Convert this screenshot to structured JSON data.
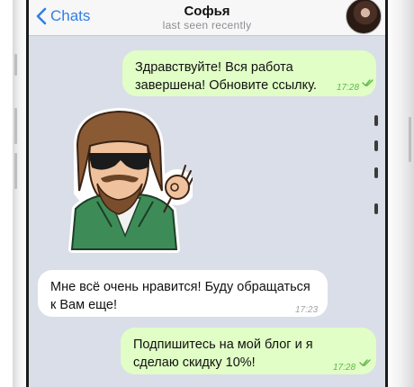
{
  "header": {
    "back_label": "Chats",
    "title": "Софья",
    "status": "last seen recently"
  },
  "messages": [
    {
      "direction": "out",
      "text": "Здравствуйте! Вся работа\nзавершена! Обновите ссылку.",
      "time": "17:28"
    },
    {
      "direction": "in",
      "type": "sticker",
      "sticker": "bearded-man-sunglasses-ok-sticker"
    },
    {
      "direction": "in",
      "text": "Мне всё очень нравится! Буду обращаться\nк Вам еще!",
      "time": "17:23"
    },
    {
      "direction": "out",
      "text": "Подпишитесь на мой блог и я\nсделаю скидку 10%!",
      "time": "17:28"
    }
  ],
  "colors": {
    "accent": "#2f7fe8",
    "outgoing_bubble": "#e1fec6",
    "incoming_bubble": "#ffffff",
    "chat_background": "#dadee8",
    "read_checks": "#5fb84a"
  },
  "icons": {
    "back": "chevron-left-icon",
    "read_status": "double-check-icon"
  }
}
